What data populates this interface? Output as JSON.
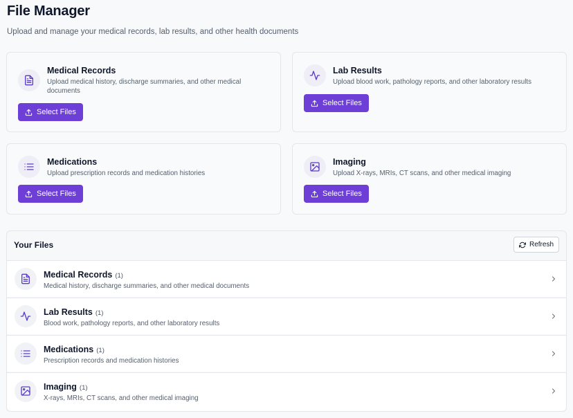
{
  "page": {
    "title": "File Manager",
    "subtitle": "Upload and manage your medical records, lab results, and other health documents"
  },
  "upload_cards": [
    {
      "title": "Medical Records",
      "description": "Upload medical history, discharge summaries, and other medical documents",
      "button": "Select Files",
      "icon": "document-icon"
    },
    {
      "title": "Lab Results",
      "description": "Upload blood work, pathology reports, and other laboratory results",
      "button": "Select Files",
      "icon": "activity-icon"
    },
    {
      "title": "Medications",
      "description": "Upload prescription records and medication histories",
      "button": "Select Files",
      "icon": "list-icon"
    },
    {
      "title": "Imaging",
      "description": "Upload X-rays, MRIs, CT scans, and other medical imaging",
      "button": "Select Files",
      "icon": "image-icon"
    }
  ],
  "files": {
    "title": "Your Files",
    "refresh_label": "Refresh",
    "categories": [
      {
        "name": "Medical Records",
        "count": "(1)",
        "description": "Medical history, discharge summaries, and other medical documents",
        "icon": "document-icon"
      },
      {
        "name": "Lab Results",
        "count": "(1)",
        "description": "Blood work, pathology reports, and other laboratory results",
        "icon": "activity-icon"
      },
      {
        "name": "Medications",
        "count": "(1)",
        "description": "Prescription records and medication histories",
        "icon": "list-icon"
      },
      {
        "name": "Imaging",
        "count": "(1)",
        "description": "X-rays, MRIs, CT scans, and other medical imaging",
        "icon": "image-icon"
      }
    ]
  },
  "colors": {
    "accent": "#6d3fd6",
    "icon_stroke": "#5b3cc4"
  }
}
